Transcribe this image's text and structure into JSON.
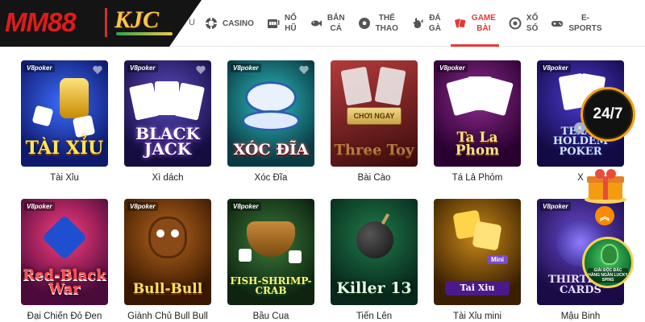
{
  "brand": {
    "logo_main": "MM88",
    "logo_secondary": "KJC",
    "nav_stub": "U"
  },
  "nav": {
    "items": [
      {
        "label": "CASINO",
        "label2": "",
        "icon": "casino-chip-icon",
        "active": false
      },
      {
        "label": "NỔ",
        "label2": "HŨ",
        "icon": "slot-machine-icon",
        "active": false
      },
      {
        "label": "BẮN",
        "label2": "CÁ",
        "icon": "fish-icon",
        "active": false
      },
      {
        "label": "THỂ",
        "label2": "THAO",
        "icon": "soccer-ball-icon",
        "active": false
      },
      {
        "label": "ĐÁ",
        "label2": "GÀ",
        "icon": "rooster-icon",
        "active": false
      },
      {
        "label": "GAME",
        "label2": "BÀI",
        "icon": "cards-icon",
        "active": true
      },
      {
        "label": "XỔ",
        "label2": "SỐ",
        "icon": "lottery-icon",
        "active": false
      },
      {
        "label": "E-",
        "label2": "SPORTS",
        "icon": "gamepad-icon",
        "active": false
      }
    ]
  },
  "games": [
    {
      "caption": "Tài Xỉu",
      "art": "TÀI XỈU",
      "brand": "V8poker"
    },
    {
      "caption": "Xì dách",
      "art": "BLACK JACK",
      "brand": "V8poker"
    },
    {
      "caption": "Xóc Đĩa",
      "art": "XÓC ĐĨA",
      "brand": "V8poker"
    },
    {
      "caption": "Bài Cào",
      "art": "Three Toy",
      "brand": "",
      "play": "CHƠI NGAY"
    },
    {
      "caption": "Tá Lả Phỏm",
      "art": "Ta La Phom",
      "brand": "V8poker"
    },
    {
      "caption": "X",
      "art": "TEXAS HOLDEM POKER",
      "brand": "V8poker"
    },
    {
      "caption": "Đại Chiến Đỏ Đen",
      "art": "Red-Black War",
      "brand": "V8poker"
    },
    {
      "caption": "Giành Chủ Bull Bull",
      "art": "Bull-Bull",
      "brand": "V8poker"
    },
    {
      "caption": "Bầu Cua",
      "art": "FISH-SHRIMP-CRAB",
      "brand": "V8poker"
    },
    {
      "caption": "Tiến Lên",
      "art": "Killer 13",
      "brand": ""
    },
    {
      "caption": "Tài Xỉu mini",
      "art": "Tai Xiu",
      "brand": "",
      "badge": "Mini"
    },
    {
      "caption": "Mậu Binh",
      "art": "THIRTEEN CARDS",
      "brand": "V8poker"
    }
  ],
  "floating": {
    "support_badge": "24/7",
    "close": "×",
    "scroll_top": "︽",
    "promo_text": "GIẢI ĐỘC ĐẮC HÀNG NGÀN LUCKY SPINS"
  },
  "colors": {
    "accent": "#e53935",
    "gold": "#f3a21c"
  }
}
